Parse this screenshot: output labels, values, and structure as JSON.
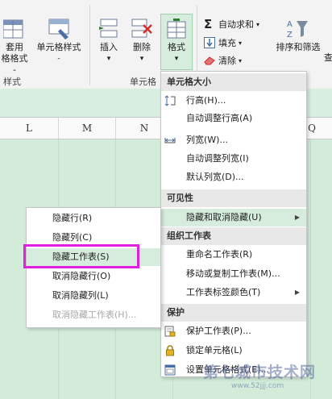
{
  "ribbon": {
    "table_format_line1": "套用",
    "table_format_line2": "格格式 -",
    "cell_style": "单元格样式",
    "cell_style_arrow": "-",
    "styles_group": "样式",
    "insert": "插入",
    "delete": "删除",
    "format": "格式",
    "dropdown_arrow": "▾",
    "cells_group": "单元格",
    "autosum": "自动求和",
    "fill": "填充",
    "clear": "清除",
    "sort_filter": "排序和筛选",
    "find_select": "查"
  },
  "columns": [
    "L",
    "M",
    "N",
    "Q"
  ],
  "main_menu": {
    "cell_size_header": "单元格大小",
    "row_height": "行高(H)...",
    "autofit_row": "自动调整行高(A)",
    "col_width": "列宽(W)...",
    "autofit_col": "自动调整列宽(I)",
    "default_width": "默认列宽(D)...",
    "visibility_header": "可见性",
    "hide_unhide": "隐藏和取消隐藏(U)",
    "organize_header": "组织工作表",
    "rename": "重命名工作表(R)",
    "move_copy": "移动或复制工作表(M)...",
    "tab_color": "工作表标签颜色(T)",
    "protect_header": "保护",
    "protect_sheet": "保护工作表(P)...",
    "lock_cell": "锁定单元格(L)",
    "format_cells": "设置单元格格式(E)..."
  },
  "sub_menu": {
    "hide_rows": "隐藏行(R)",
    "hide_cols": "隐藏列(C)",
    "hide_sheet": "隐藏工作表(S)",
    "unhide_rows": "取消隐藏行(O)",
    "unhide_cols": "取消隐藏列(L)",
    "unhide_sheet": "取消隐藏工作表(H)..."
  },
  "watermark": {
    "text": "第七城市技术网",
    "url": "www.52jjj.com"
  },
  "colors": {
    "accent_green": "#217346",
    "highlight": "#d6ecdd",
    "selection_box": "#e020e0"
  }
}
